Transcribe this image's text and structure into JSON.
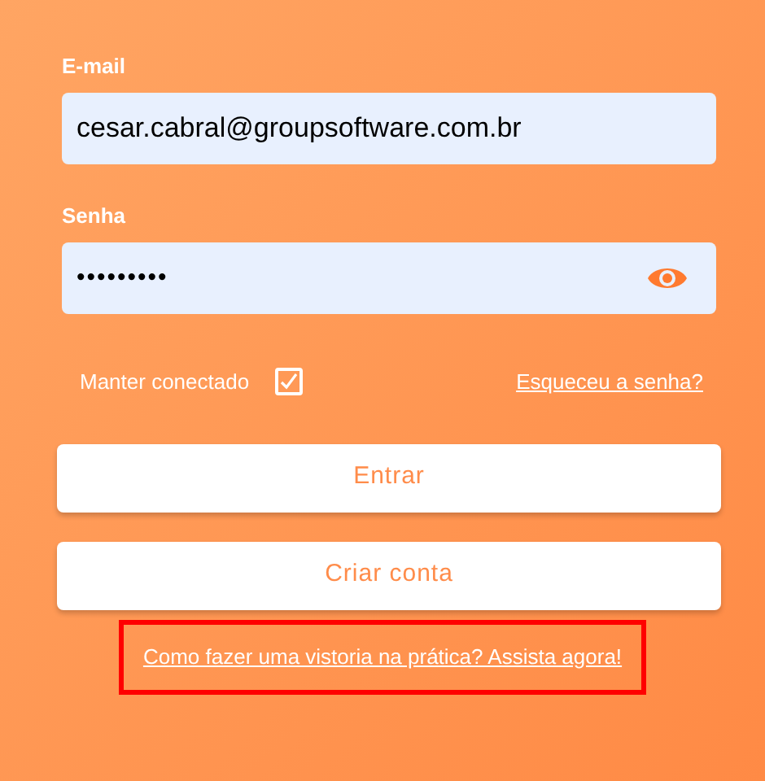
{
  "email": {
    "label": "E-mail",
    "value": "cesar.cabral@groupsoftware.com.br"
  },
  "password": {
    "label": "Senha",
    "value": "•••••••••"
  },
  "remember": {
    "label": "Manter conectado",
    "checked": true
  },
  "forgot_link": "Esqueceu a senha?",
  "buttons": [
    "Entrar",
    "Criar conta"
  ],
  "tutorial_link": {
    "text": "Como fazer uma vistoria na prática? Assista agora!",
    "highlighted": true
  }
}
